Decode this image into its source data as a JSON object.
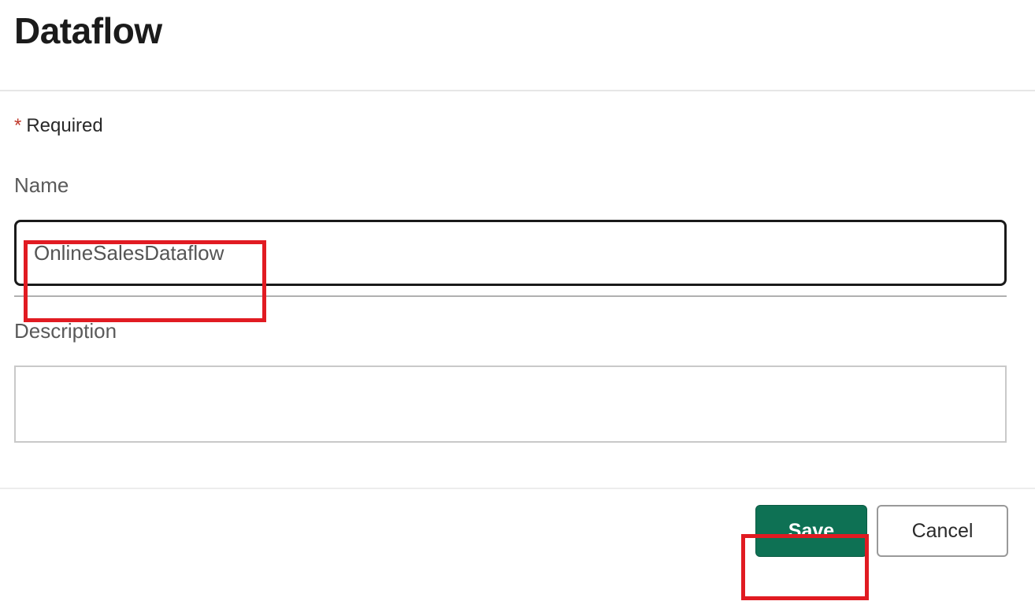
{
  "header": {
    "title": "Dataflow"
  },
  "form": {
    "required_label": "Required",
    "name_label": "Name",
    "name_value": "OnlineSalesDataflow",
    "description_label": "Description",
    "description_value": ""
  },
  "buttons": {
    "save": "Save",
    "cancel": "Cancel"
  },
  "colors": {
    "primary_button_bg": "#0e7154",
    "highlight_border": "#e11b22"
  }
}
